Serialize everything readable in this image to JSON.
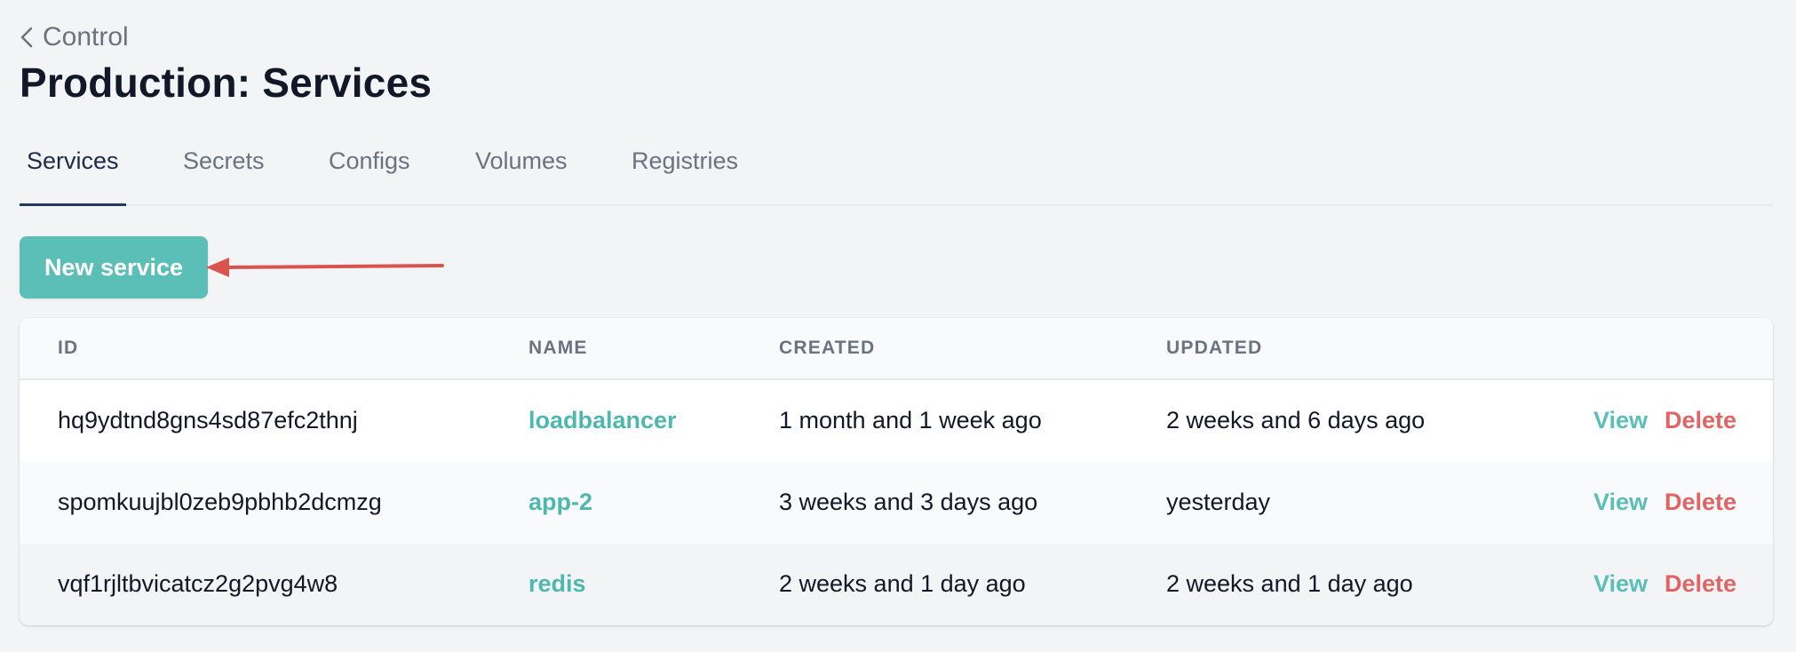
{
  "header": {
    "back_label": "Control",
    "title": "Production: Services"
  },
  "tabs": [
    {
      "label": "Services",
      "active": true
    },
    {
      "label": "Secrets",
      "active": false
    },
    {
      "label": "Configs",
      "active": false
    },
    {
      "label": "Volumes",
      "active": false
    },
    {
      "label": "Registries",
      "active": false
    }
  ],
  "toolbar": {
    "new_service_label": "New service"
  },
  "annotation": {
    "arrow_color": "#d9534f",
    "points_to": "New service"
  },
  "table": {
    "columns": [
      "ID",
      "NAME",
      "CREATED",
      "UPDATED"
    ],
    "rows": [
      {
        "id": "hq9ydtnd8gns4sd87efc2thnj",
        "name": "loadbalancer",
        "created": "1 month and 1 week ago",
        "updated": "2 weeks and 6 days ago",
        "view": "View",
        "delete": "Delete"
      },
      {
        "id": "spomkuujbl0zeb9pbhb2dcmzg",
        "name": "app-2",
        "created": "3 weeks and 3 days ago",
        "updated": "yesterday",
        "view": "View",
        "delete": "Delete"
      },
      {
        "id": "vqf1rjltbvicatcz2g2pvg4w8",
        "name": "redis",
        "created": "2 weeks and 1 day ago",
        "updated": "2 weeks and 1 day ago",
        "view": "View",
        "delete": "Delete"
      }
    ]
  },
  "colors": {
    "accent": "#5bbfb7",
    "danger": "#e06464",
    "title": "#111827",
    "muted": "#6b7280"
  }
}
